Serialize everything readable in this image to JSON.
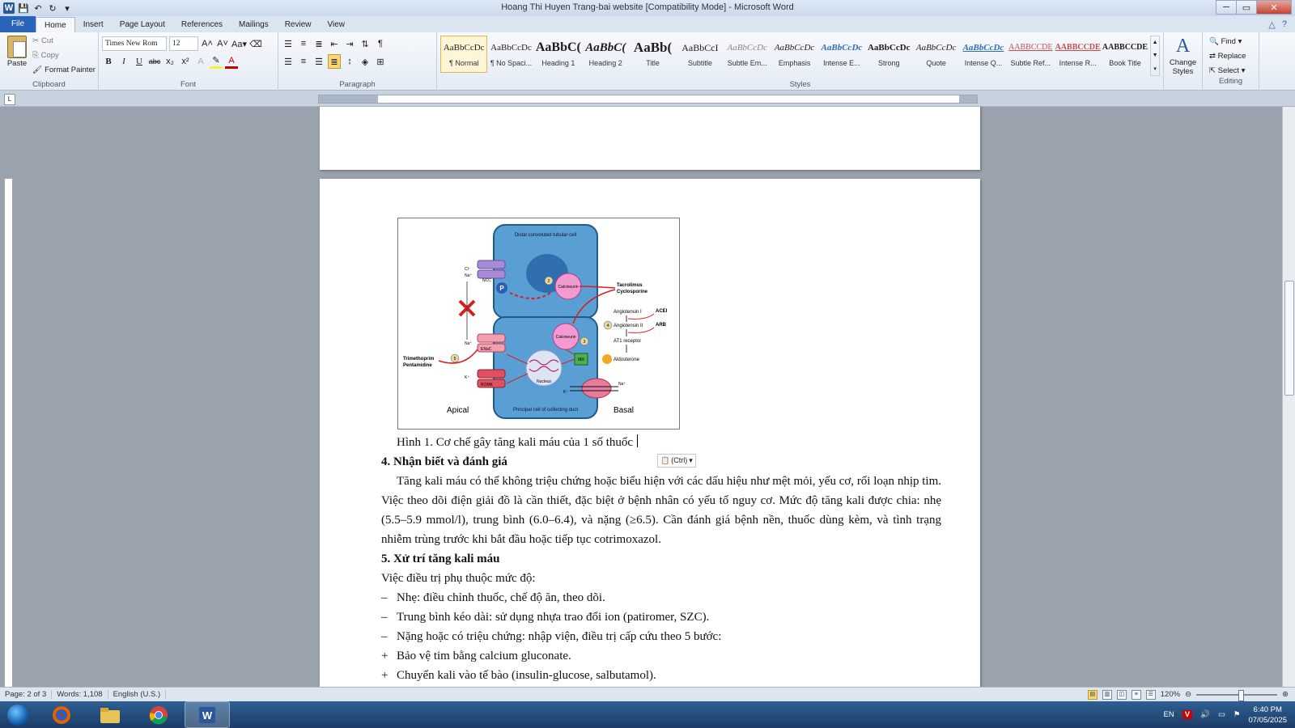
{
  "window": {
    "title": "Hoang Thi Huyen Trang-bai website [Compatibility Mode] - Microsoft Word"
  },
  "quick_access": [
    "save-icon",
    "undo-icon",
    "redo-icon",
    "customize-icon"
  ],
  "tabs": [
    {
      "label": "File"
    },
    {
      "label": "Home"
    },
    {
      "label": "Insert"
    },
    {
      "label": "Page Layout"
    },
    {
      "label": "References"
    },
    {
      "label": "Mailings"
    },
    {
      "label": "Review"
    },
    {
      "label": "View"
    }
  ],
  "ribbon": {
    "clipboard": {
      "paste": "Paste",
      "cut": "Cut",
      "copy": "Copy",
      "format_painter": "Format Painter",
      "label": "Clipboard"
    },
    "font": {
      "name": "Times New Rom",
      "size": "12",
      "label": "Font",
      "bold": "B",
      "italic": "I",
      "underline": "U",
      "strike": "abc",
      "sub": "x₂",
      "sup": "x²",
      "grow": "A˄",
      "shrink": "A˅",
      "case": "Aa▾"
    },
    "paragraph": {
      "label": "Paragraph"
    },
    "styles": {
      "label": "Styles",
      "items": [
        {
          "preview": "AaBbCcDc",
          "name": "¶ Normal"
        },
        {
          "preview": "AaBbCcDc",
          "name": "¶ No Spaci..."
        },
        {
          "preview": "AaBbC(",
          "name": "Heading 1"
        },
        {
          "preview": "AaBbC(",
          "name": "Heading 2"
        },
        {
          "preview": "AaBb(",
          "name": "Title"
        },
        {
          "preview": "AaBbCcI",
          "name": "Subtitle"
        },
        {
          "preview": "AaBbCcDc",
          "name": "Subtle Em..."
        },
        {
          "preview": "AaBbCcDc",
          "name": "Emphasis"
        },
        {
          "preview": "AaBbCcDc",
          "name": "Intense E..."
        },
        {
          "preview": "AaBbCcDc",
          "name": "Strong"
        },
        {
          "preview": "AaBbCcDc",
          "name": "Quote"
        },
        {
          "preview": "AaBbCcDc",
          "name": "Intense Q..."
        },
        {
          "preview": "AABBCCDE",
          "name": "Subtle Ref..."
        },
        {
          "preview": "AABBCCDE",
          "name": "Intense R..."
        },
        {
          "preview": "AABBCCDE",
          "name": "Book Title"
        }
      ],
      "change": "Change Styles"
    },
    "editing": {
      "label": "Editing",
      "find": "Find",
      "replace": "Replace",
      "select": "Select"
    }
  },
  "document": {
    "figure": {
      "top_label": "Distal convoluted tubular cell",
      "bottom_label": "Principal cell of collecting duct",
      "apical": "Apical",
      "basal": "Basal",
      "calcineurin": "Calcineurin",
      "tacrolimus": "Tacrolimus",
      "cyclosporine": "Cyclosporine",
      "ang1": "Angiotensin I",
      "ang2": "Angiotensin II",
      "at1": "AT1 receptor",
      "acei": "ACEI",
      "arb": "ARB",
      "aldosterone": "Aldosterone",
      "mr": "MR",
      "enac": "ENaC",
      "romk": "ROMK",
      "ncc": "NCC",
      "nucleus": "Nucleus",
      "trimethoprim": "Trimethoprim",
      "pentamidine": "Pentamidine",
      "cl": "Cl⁻",
      "na": "Na⁺",
      "k": "K⁺",
      "p": "P",
      "n1": "1",
      "n2": "2",
      "n3": "3",
      "n4": "4",
      "n5": "5"
    },
    "caption": "Hình 1. Cơ chế gây tăng kali máu của 1 số thuốc",
    "paste_options": "(Ctrl)",
    "heading4": "4. Nhận biết và đánh giá",
    "para4": "Tăng kali máu có thể không triệu chứng hoặc biểu hiện với các dấu hiệu như mệt mỏi, yếu cơ, rối loạn nhịp tim. Việc theo dõi điện giải đồ là cần thiết, đặc biệt ở bệnh nhân có yếu tố nguy cơ. Mức độ tăng kali được chia: nhẹ (5.5–5.9 mmol/l), trung bình (6.0–6.4), và nặng (≥6.5). Cần đánh giá bệnh nền, thuốc dùng kèm, và tình trạng nhiễm trùng trước khi bắt đầu hoặc tiếp tục cotrimoxazol.",
    "heading5": "5. Xử trí tăng kali máu",
    "para5": "Việc điều trị phụ thuộc mức độ:",
    "list": [
      {
        "marker": "–",
        "text": "Nhẹ: điều chỉnh thuốc, chế độ ăn, theo dõi."
      },
      {
        "marker": "–",
        "text": "Trung bình kéo dài: sử dụng nhựa trao đổi ion (patiromer, SZC)."
      },
      {
        "marker": "–",
        "text": "Nặng hoặc có triệu chứng: nhập viện, điều trị cấp cứu theo 5 bước:"
      },
      {
        "marker": "+",
        "text": "Bảo vệ tim bằng calcium gluconate."
      },
      {
        "marker": "+",
        "text": "Chuyển kali vào tế bào (insulin-glucose, salbutamol)."
      }
    ]
  },
  "statusbar": {
    "page": "Page: 2 of 3",
    "words": "Words: 1,108",
    "language": "English (U.S.)",
    "zoom": "120%"
  },
  "taskbar": {
    "apps": [
      "firefox-icon",
      "explorer-icon",
      "chrome-icon",
      "word-icon"
    ],
    "lang": "EN",
    "time": "6:40 PM",
    "date": "07/05/2025"
  },
  "colors": {
    "cell_blue": "#5a9fd4",
    "cell_stroke": "#1f5a8a",
    "red": "#d42020",
    "pink": "#f39bd0",
    "word_blue": "#2b579a"
  }
}
